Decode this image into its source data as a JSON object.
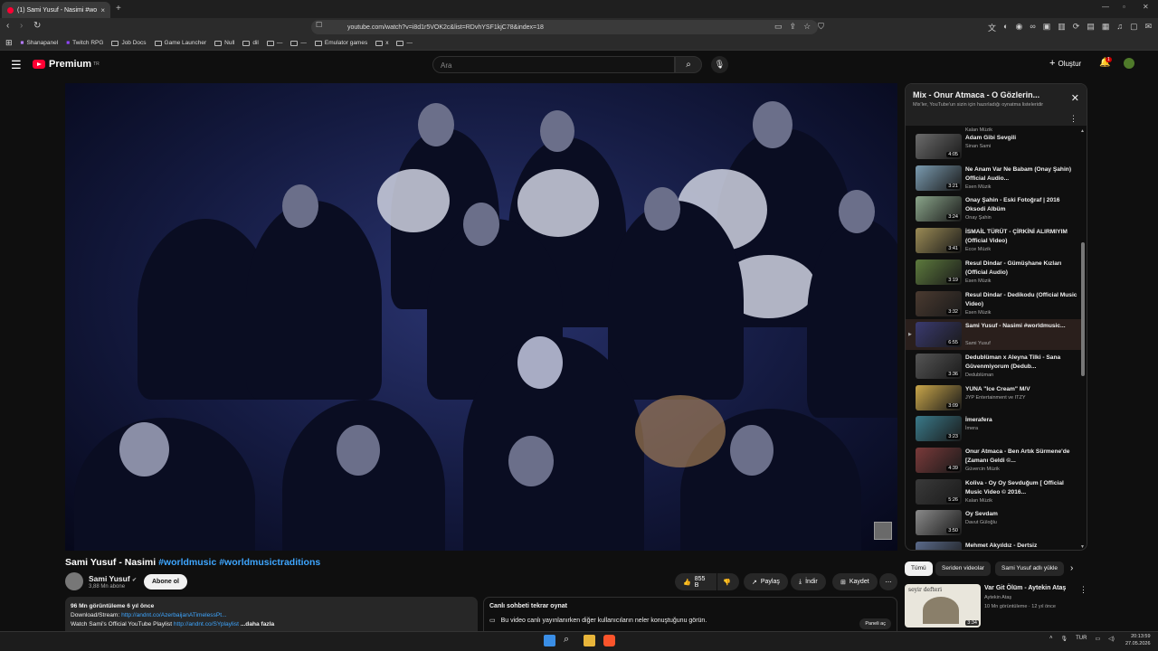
{
  "browser": {
    "tab_title": "(1) Sami Yusuf - Nasimi #wo",
    "url": "youtube.com/watch?v=i8d1r5VOK2c&list=RDvhYSF1kjC78&index=18",
    "bookmarks": [
      "Shanapanel",
      "Twitch RPG",
      "Job Docs",
      "Game Launcher",
      "Null",
      "dil",
      "—",
      "—",
      "Emulator games",
      "x",
      "—"
    ]
  },
  "header": {
    "logo": "Premium",
    "region": "TR",
    "search_placeholder": "Ara",
    "create_label": "Oluştur",
    "notif_count": "1"
  },
  "video": {
    "title_plain": "Sami Yusuf - Nasimi ",
    "title_tags": "#worldmusic #worldmusictraditions",
    "channel": "Sami Yusuf",
    "subscribers": "3,88 Mn abone",
    "subscribe_label": "Abone ol",
    "likes": "855 B",
    "share_label": "Paylaş",
    "download_label": "İndir",
    "save_label": "Kaydet"
  },
  "description": {
    "stats": "96 Mn görüntüleme  6 yıl önce",
    "line1_text": "Download/Stream: ",
    "line1_link": "http://andnt.co/AzerbaijanATimelessPt...",
    "line2_text": "Watch Sami's Official YouTube Playlist ",
    "line2_link": "http://andnt.co/SYplaylist",
    "more": " ...daha fazla"
  },
  "chat": {
    "title": "Canlı sohbeti tekrar oynat",
    "body": "Bu video canlı yayınlanırken diğer kullanıcıların neler konuştuğunu görün.",
    "open_label": "Paneli aç"
  },
  "playlist": {
    "title": "Mix - Onur Atmaca - O Gözlerin...",
    "subtitle": "Mix'ler, YouTube'un sizin için hazırladığı oynatma listeleridir",
    "top_channel": "Kalan Müzik",
    "items": [
      {
        "title": "Adam Gibi Sevgili",
        "channel": "Sinan Sami",
        "duration": "4:05",
        "color": "#6b6b6b"
      },
      {
        "title": "Ne Anam Var Ne Babam (Onay Şahin) Official Audio...",
        "channel": "Esen Müzik",
        "duration": "3:21",
        "color": "#7a9bb0"
      },
      {
        "title": "Onay Şahin - Eski Fotoğraf | 2016 Oksodi Albüm",
        "channel": "Onay Şahin",
        "duration": "3:24",
        "color": "#8aa58a"
      },
      {
        "title": "İSMAİL TÜRÜT - ÇİRKİNİ ALIRMIYIM (Official Video)",
        "channel": "Ecce Müzik",
        "duration": "3:41",
        "color": "#9b8b55"
      },
      {
        "title": "Resul Dindar - Gümüşhane Kızları (Official Audio)",
        "channel": "Esen Müzik",
        "duration": "3:19",
        "color": "#5d7a3d"
      },
      {
        "title": "Resul Dindar - Dedikodu (Official Music Video)",
        "channel": "Esen Müzik",
        "duration": "3:32",
        "color": "#4a3a30"
      },
      {
        "title": "Sami Yusuf - Nasimi #worldmusic...",
        "channel": "Sami Yusuf",
        "duration": "6:55",
        "color": "#3a3a70"
      },
      {
        "title": "Dedublüman x Aleyna Tilki - Sana Güvenmiyorum (Dedub...",
        "channel": "Dedublüman",
        "duration": "3:36",
        "color": "#555555"
      },
      {
        "title": "YUNA \"Ice Cream\" M/V",
        "channel": "JYP Entertainment ve ITZY",
        "duration": "3:09",
        "color": "#c9a64a"
      },
      {
        "title": "İmerafera",
        "channel": "İmera",
        "duration": "3:23",
        "color": "#3a7a8a"
      },
      {
        "title": "Onur Atmaca - Ben Artık Sürmene'de [Zamanı Geldi ©...",
        "channel": "Güvercin Müzik",
        "duration": "4:39",
        "color": "#7a3a3a"
      },
      {
        "title": "Koliva - Oy Oy Sevduğum [ Official Music Video © 2016...",
        "channel": "Kalan Müzik",
        "duration": "5:26",
        "color": "#3a3a3a"
      },
      {
        "title": "Oy Sevdam",
        "channel": "Davut Güloğlu",
        "duration": "3:50",
        "color": "#8a8a8a"
      },
      {
        "title": "Mehmet Akyıldız - Dertsiz",
        "channel": "",
        "duration": "",
        "color": "#5a6a8a"
      }
    ]
  },
  "chips": [
    "Tümü",
    "Seriden videolar",
    "Sami Yusuf adlı yükle"
  ],
  "recommended": {
    "title": "Var Git Ölüm - Aytekin Ataş",
    "channel": "Aytekin Ataş",
    "meta": "10 Mn görüntüleme · 12 yıl önce",
    "duration": "3:34",
    "thumb_text": "seyir defteri"
  },
  "taskbar": {
    "lang": "TUR",
    "time": "20:13:59",
    "date": "27.05.2026"
  }
}
